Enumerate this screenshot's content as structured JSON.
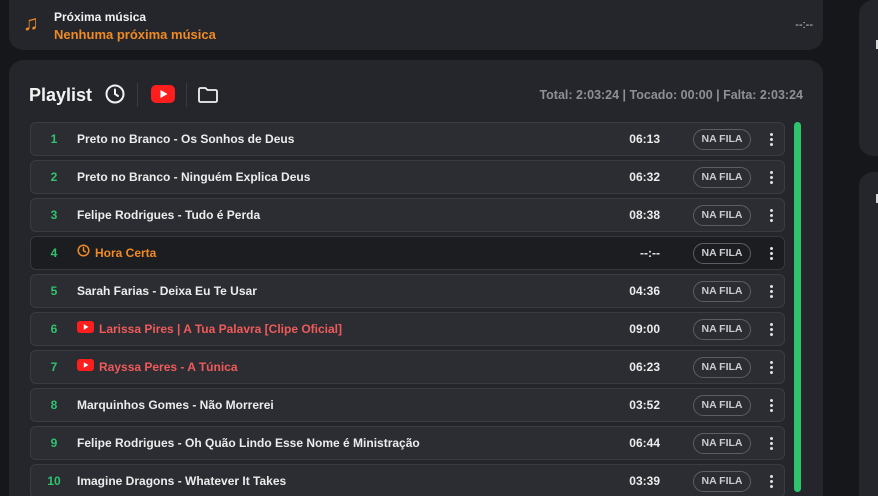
{
  "next": {
    "label": "Próxima música",
    "title": "Nenhuma próxima música",
    "time": "--:--"
  },
  "playlist": {
    "title": "Playlist",
    "totals": "Total: 2:03:24 | Tocado: 00:00 | Falta: 2:03:24",
    "tracks": [
      {
        "num": "1",
        "title": "Preto no Branco - Os Sonhos de Deus",
        "duration": "06:13",
        "status": "NA FILA",
        "kind": "music"
      },
      {
        "num": "2",
        "title": "Preto no Branco - Ninguém Explica Deus",
        "duration": "06:32",
        "status": "NA FILA",
        "kind": "music"
      },
      {
        "num": "3",
        "title": "Felipe Rodrigues - Tudo é Perda",
        "duration": "08:38",
        "status": "NA FILA",
        "kind": "music"
      },
      {
        "num": "4",
        "title": "Hora Certa",
        "duration": "--:--",
        "status": "NA FILA",
        "kind": "clock"
      },
      {
        "num": "5",
        "title": "Sarah Farias - Deixa Eu Te Usar",
        "duration": "04:36",
        "status": "NA FILA",
        "kind": "music"
      },
      {
        "num": "6",
        "title": "Larissa Pires | A Tua Palavra [Clipe Oficial]",
        "duration": "09:00",
        "status": "NA FILA",
        "kind": "youtube"
      },
      {
        "num": "7",
        "title": "Rayssa Peres - A Túnica",
        "duration": "06:23",
        "status": "NA FILA",
        "kind": "youtube"
      },
      {
        "num": "8",
        "title": "Marquinhos Gomes - Não Morrerei",
        "duration": "03:52",
        "status": "NA FILA",
        "kind": "music"
      },
      {
        "num": "9",
        "title": "Felipe Rodrigues - Oh Quão Lindo Esse Nome é  Ministração",
        "duration": "06:44",
        "status": "NA FILA",
        "kind": "music"
      },
      {
        "num": "10",
        "title": "Imagine Dragons - Whatever It Takes",
        "duration": "03:39",
        "status": "NA FILA",
        "kind": "music"
      }
    ]
  },
  "icons": {
    "next": "music-note-icon",
    "clock": "clock-icon",
    "youtube": "youtube-icon",
    "folder": "folder-icon",
    "menu": "more-vertical-icon"
  },
  "colors": {
    "accent": "#f08a24",
    "number": "#2ec46e",
    "youtube": "#ef5a5a",
    "scrollbar": "#2ec46e"
  }
}
